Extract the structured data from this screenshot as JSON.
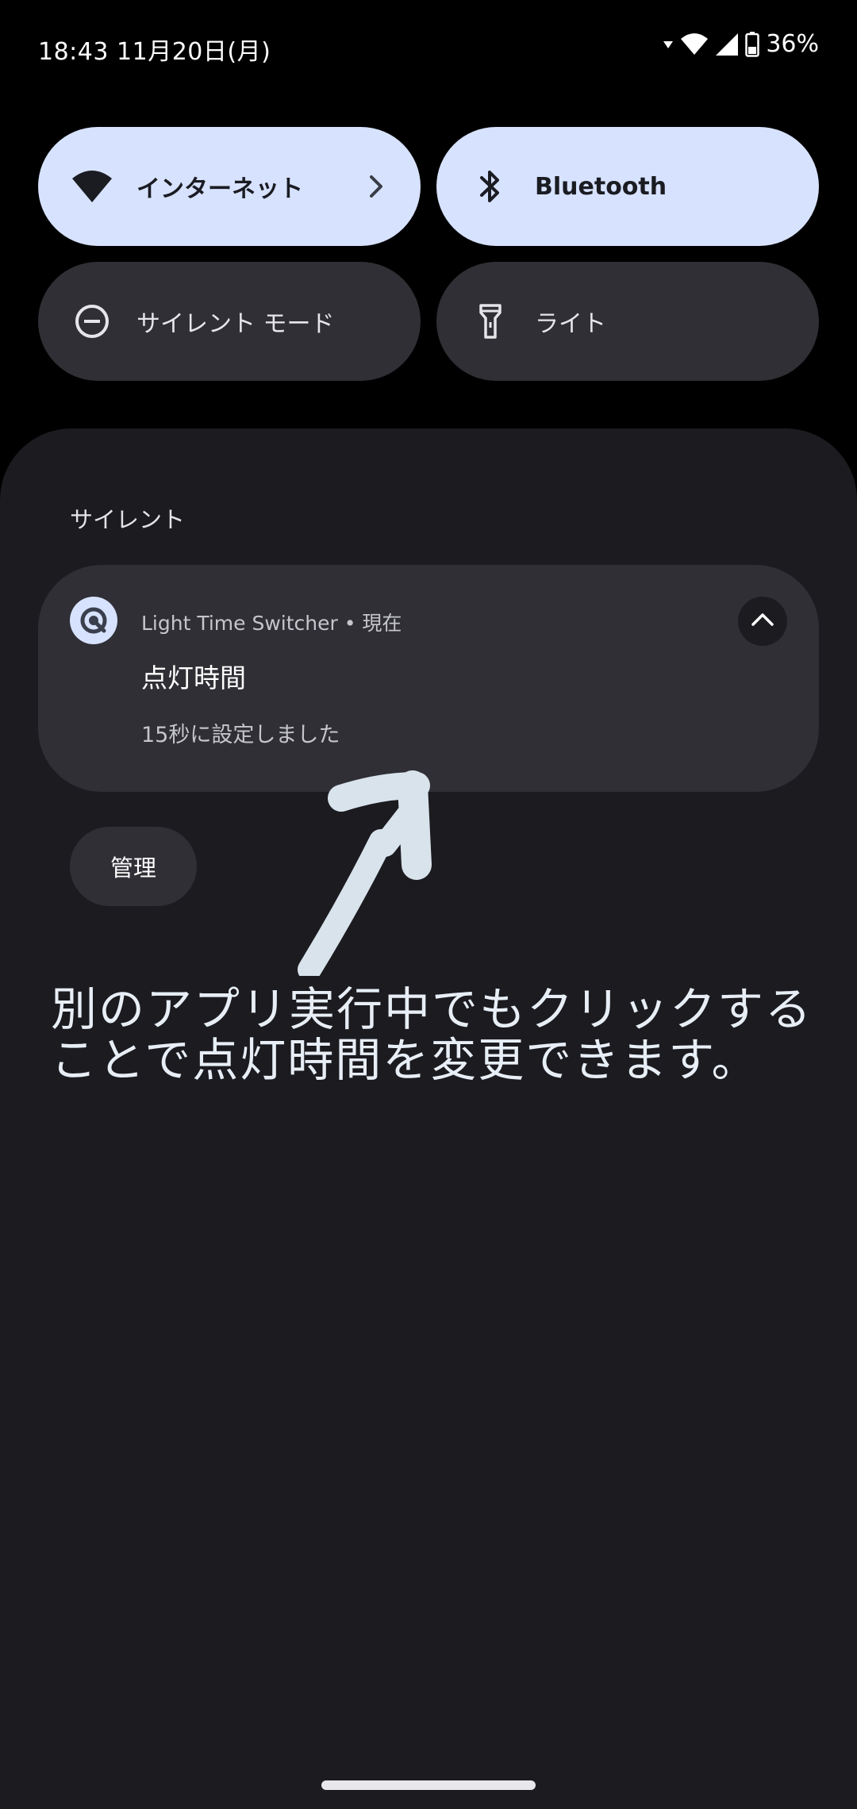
{
  "status_bar": {
    "time": "18:43",
    "date": "11月20日(月)",
    "battery": "36%",
    "icons": [
      "data-activity-icon",
      "wifi-icon",
      "cell-signal-icon",
      "battery-icon"
    ]
  },
  "quick_settings": {
    "tiles": [
      {
        "label": "インターネット",
        "icon": "wifi-icon",
        "state": "on",
        "has_chevron": true
      },
      {
        "label": "Bluetooth",
        "icon": "bluetooth-icon",
        "state": "on"
      },
      {
        "label": "サイレント モード",
        "icon": "do-not-disturb-icon",
        "state": "off"
      },
      {
        "label": "ライト",
        "icon": "flashlight-icon",
        "state": "off"
      }
    ]
  },
  "notifications": {
    "section_title": "サイレント",
    "items": [
      {
        "app_name": "Light Time Switcher",
        "time": "現在",
        "meta": "Light Time Switcher • 現在",
        "title": "点灯時間",
        "text": "15秒に設定しました",
        "icon": "app-timer-icon"
      }
    ],
    "manage_label": "管理"
  },
  "annotation": {
    "text": "別のアプリ実行中でもクリックすることで点灯時間を変更できます。",
    "icon": "hand-drawn-arrow"
  },
  "colors": {
    "active_tile": "#d7e2ff",
    "inactive_tile": "#2f2f35",
    "shade_bg": "#1b1b20",
    "background": "#000000"
  }
}
